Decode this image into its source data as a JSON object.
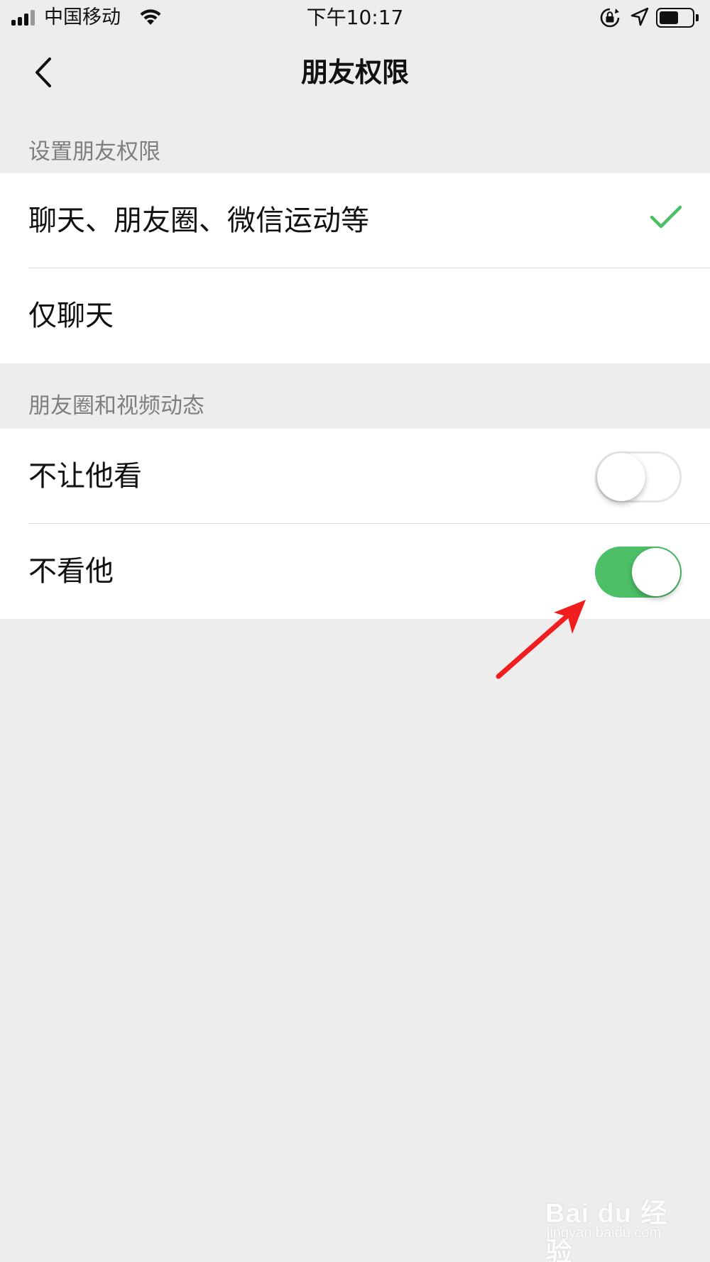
{
  "status_bar": {
    "carrier": "中国移动",
    "time": "下午10:17",
    "battery_level": 0.6
  },
  "navbar": {
    "title": "朋友权限",
    "back_icon": "chevron-left-icon"
  },
  "sections": [
    {
      "header": "设置朋友权限",
      "items": [
        {
          "label": "聊天、朋友圈、微信运动等",
          "selected": true,
          "icon": "check-icon"
        },
        {
          "label": "仅聊天",
          "selected": false
        }
      ]
    },
    {
      "header": "朋友圈和视频动态",
      "items": [
        {
          "label": "不让他看",
          "toggle": false
        },
        {
          "label": "不看他",
          "toggle": true
        }
      ]
    }
  ],
  "colors": {
    "background": "#ededed",
    "accent_green": "#4cbf67",
    "annotation_red": "#f01e1e"
  },
  "watermark": {
    "brand": "Bai du 经验",
    "url": "jingyan.baidu.com"
  }
}
